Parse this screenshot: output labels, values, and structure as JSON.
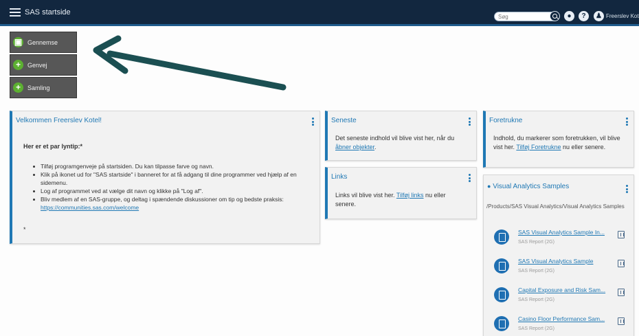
{
  "banner": {
    "app_title": "SAS startside",
    "search_placeholder": "Søg",
    "help_label": "?",
    "user_name": "Freerslev Kotel"
  },
  "quick_buttons": [
    {
      "label": "Gennemse",
      "icon": "folder-icon"
    },
    {
      "label": "Genvej",
      "icon": "plus-icon"
    },
    {
      "label": "Samling",
      "icon": "plus-icon"
    }
  ],
  "welcome": {
    "title": "Velkommen Freerslev Kotel!",
    "heading": "Her er et par lyntip:*",
    "tips": [
      "Tilføj programgenveje på startsiden. Du kan tilpasse farve og navn.",
      "Klik på ikonet ud for \"SAS startside\" i banneret for at få adgang til dine programmer ved hjælp af en sidemenu.",
      "Log af programmet ved at vælge dit navn og klikke på \"Log af\".",
      "Bliv medlem af en SAS-gruppe, og deltag i spændende diskussioner om tip og bedste praksis: "
    ],
    "tip_link": "https://communities.sas.com/welcome",
    "footnote": "*"
  },
  "recent": {
    "title": "Seneste",
    "text": "Det seneste indhold vil blive vist her, når du ",
    "link": "åbner objekter",
    "text_end": "."
  },
  "links": {
    "title": "Links",
    "text": "Links vil blive vist her. ",
    "link": "Tilføj links",
    "text_end": " nu eller senere."
  },
  "favorites": {
    "title": "Foretrukne",
    "text": "Indhold, du markerer som foretrukken, vil blive vist her. ",
    "link": "Tilføj Foretrukne",
    "text_end": " nu eller senere."
  },
  "va_samples": {
    "title": "Visual Analytics Samples",
    "path": "/Products/SAS Visual Analytics/Visual Analytics Samples",
    "items": [
      {
        "title": "SAS Visual Analytics Sample In...",
        "type": "SAS Report (2G)"
      },
      {
        "title": "SAS Visual Analytics Sample",
        "type": "SAS Report (2G)"
      },
      {
        "title": "Capital Exposure and Risk Sam...",
        "type": "SAS Report (2G)"
      },
      {
        "title": "Casino Floor Performance Sam...",
        "type": "SAS Report (2G)"
      }
    ]
  }
}
